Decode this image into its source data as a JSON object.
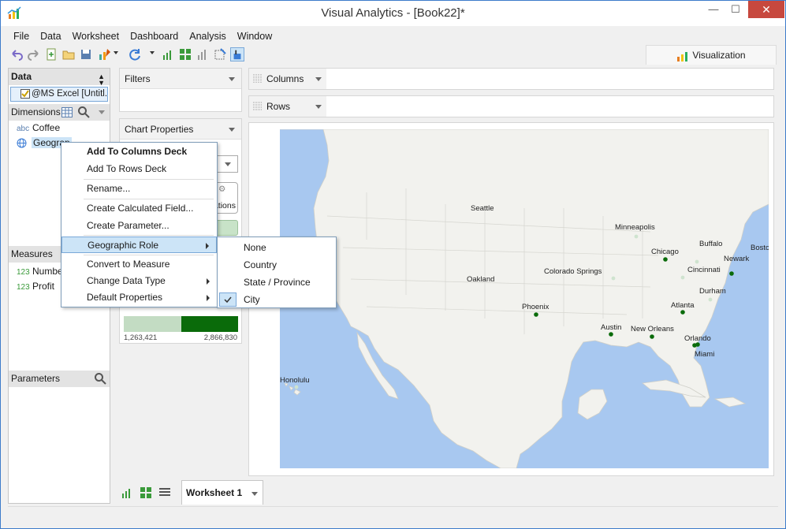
{
  "window": {
    "title": "Visual Analytics - [Book22]*",
    "close_glyph": "✕",
    "minimize_glyph": "—",
    "maximize_glyph": "☐"
  },
  "menubar": [
    "File",
    "Data",
    "Worksheet",
    "Dashboard",
    "Analysis",
    "Window"
  ],
  "visualization_tab": "Visualization",
  "data_panel": {
    "title": "Data",
    "datasource": "@MS Excel [Untitl...",
    "dimensions_label": "Dimensions",
    "dimensions": [
      {
        "type": "abc",
        "name": "Coffee"
      },
      {
        "type": "globe",
        "name": "Geograp"
      }
    ],
    "measures_label": "Measures",
    "measures": [
      {
        "type": "123",
        "name": "Number"
      },
      {
        "type": "123",
        "name": "Profit"
      }
    ],
    "parameters_label": "Parameters"
  },
  "filters_label": "Filters",
  "chart_properties_label": "Chart Properties",
  "chart_props_partial": "ations",
  "legend": {
    "min": "1,263,421",
    "max": "2,866,830",
    "color_min": "#c3dcc3",
    "color_max": "#0a6b0a"
  },
  "shelves": {
    "columns": "Columns",
    "rows": "Rows"
  },
  "context_menu": [
    {
      "label": "Add To Columns Deck",
      "bold": true
    },
    {
      "label": "Add To Rows Deck"
    },
    {
      "label": "Rename..."
    },
    {
      "label": "Create Calculated Field..."
    },
    {
      "label": "Create Parameter..."
    },
    {
      "label": "Geographic Role",
      "submenu": true,
      "highlighted": true
    },
    {
      "label": "Convert to Measure"
    },
    {
      "label": "Change Data Type",
      "submenu": true
    },
    {
      "label": "Default Properties",
      "submenu": true
    }
  ],
  "geo_submenu": [
    {
      "label": "None",
      "checked": false
    },
    {
      "label": "Country",
      "checked": false
    },
    {
      "label": "State / Province",
      "checked": false
    },
    {
      "label": "City",
      "checked": true
    }
  ],
  "map_cities": [
    {
      "name": "Seattle",
      "marker": false
    },
    {
      "name": "Minneapolis",
      "marker": false
    },
    {
      "name": "Buffalo",
      "marker": false
    },
    {
      "name": "Boston",
      "marker": false
    },
    {
      "name": "Chicago",
      "marker": true
    },
    {
      "name": "Newark",
      "marker": true
    },
    {
      "name": "Cincinnati",
      "marker": false
    },
    {
      "name": "Oakland",
      "marker": false
    },
    {
      "name": "Colorado Springs",
      "marker": false
    },
    {
      "name": "Durham",
      "marker": false
    },
    {
      "name": "Phoenix",
      "marker": true
    },
    {
      "name": "Atlanta",
      "marker": true
    },
    {
      "name": "Austin",
      "marker": true
    },
    {
      "name": "New Orleans",
      "marker": true
    },
    {
      "name": "Orlando",
      "marker": true
    },
    {
      "name": "Miami",
      "marker": true
    },
    {
      "name": "Honolulu",
      "marker": false
    }
  ],
  "colors": {
    "accent": "#3d7ccb",
    "menu_highlight": "#cce4f7",
    "close_red": "#c7483e",
    "marker": "#0a6b0a",
    "land": "#f2f2ee",
    "water": "#a8c8f0"
  },
  "worksheet_tab": "Worksheet 1"
}
